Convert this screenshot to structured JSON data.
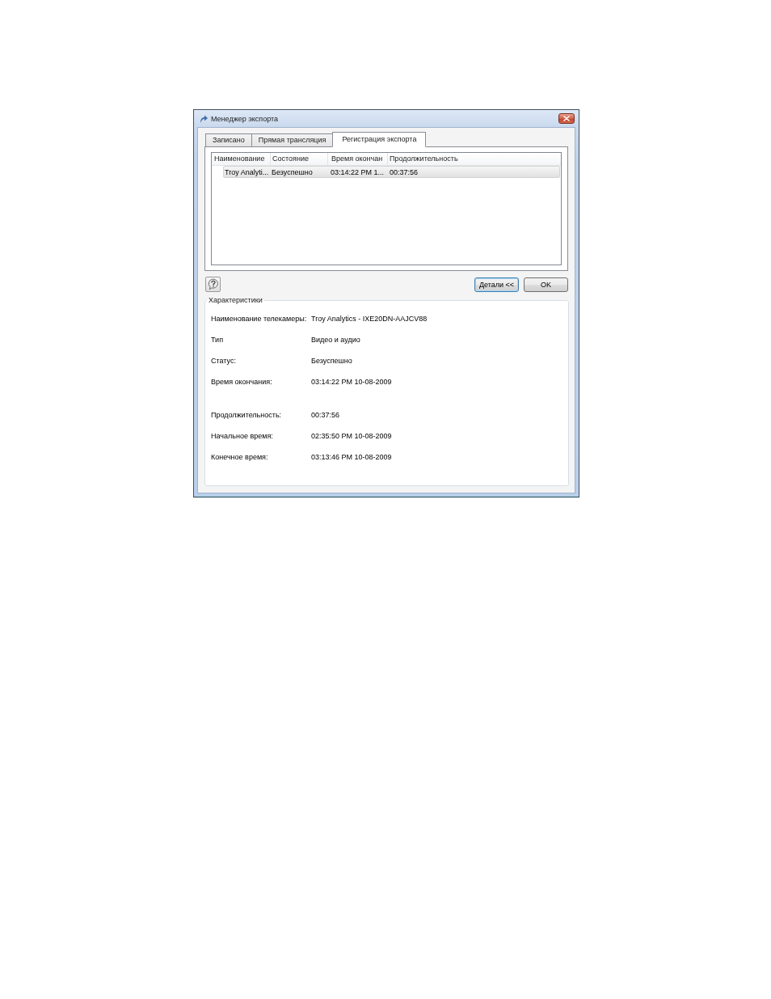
{
  "window": {
    "title": "Менеджер экспорта"
  },
  "tabs": [
    {
      "label": "Записано",
      "selected": false
    },
    {
      "label": "Прямая трансляция",
      "selected": false
    },
    {
      "label": "Регистрация экспорта",
      "selected": true
    }
  ],
  "table": {
    "columns": [
      "Наименование",
      "Состояние",
      "Время окончан",
      "Продолжительность"
    ],
    "rows": [
      {
        "cells": [
          "Troy Analyti...",
          "Безуспешно",
          "03:14:22 PM 1...",
          "00:37:56"
        ],
        "selected": true
      }
    ]
  },
  "buttons": [
    {
      "label": "Детали <<",
      "focused": true
    },
    {
      "label": "OK",
      "focused": false
    }
  ],
  "details": {
    "title": "Характеристики",
    "rows": [
      {
        "label": "Наименование телекамеры:",
        "value": "Troy Analytics - IXE20DN-AAJCV88"
      },
      {
        "label": "Тип",
        "value": "Видео и аудио"
      },
      {
        "label": "Статус:",
        "value": "Безуспешно"
      },
      {
        "label": "Время окончания:",
        "value": "03:14:22 PM 10-08-2009"
      },
      {
        "label": "Продолжительность:",
        "value": "00:37:56"
      },
      {
        "label": "Начальное время:",
        "value": "02:35:50 PM 10-08-2009"
      },
      {
        "label": "Конечное время:",
        "value": "03:13:46 PM 10-08-2009"
      }
    ]
  }
}
